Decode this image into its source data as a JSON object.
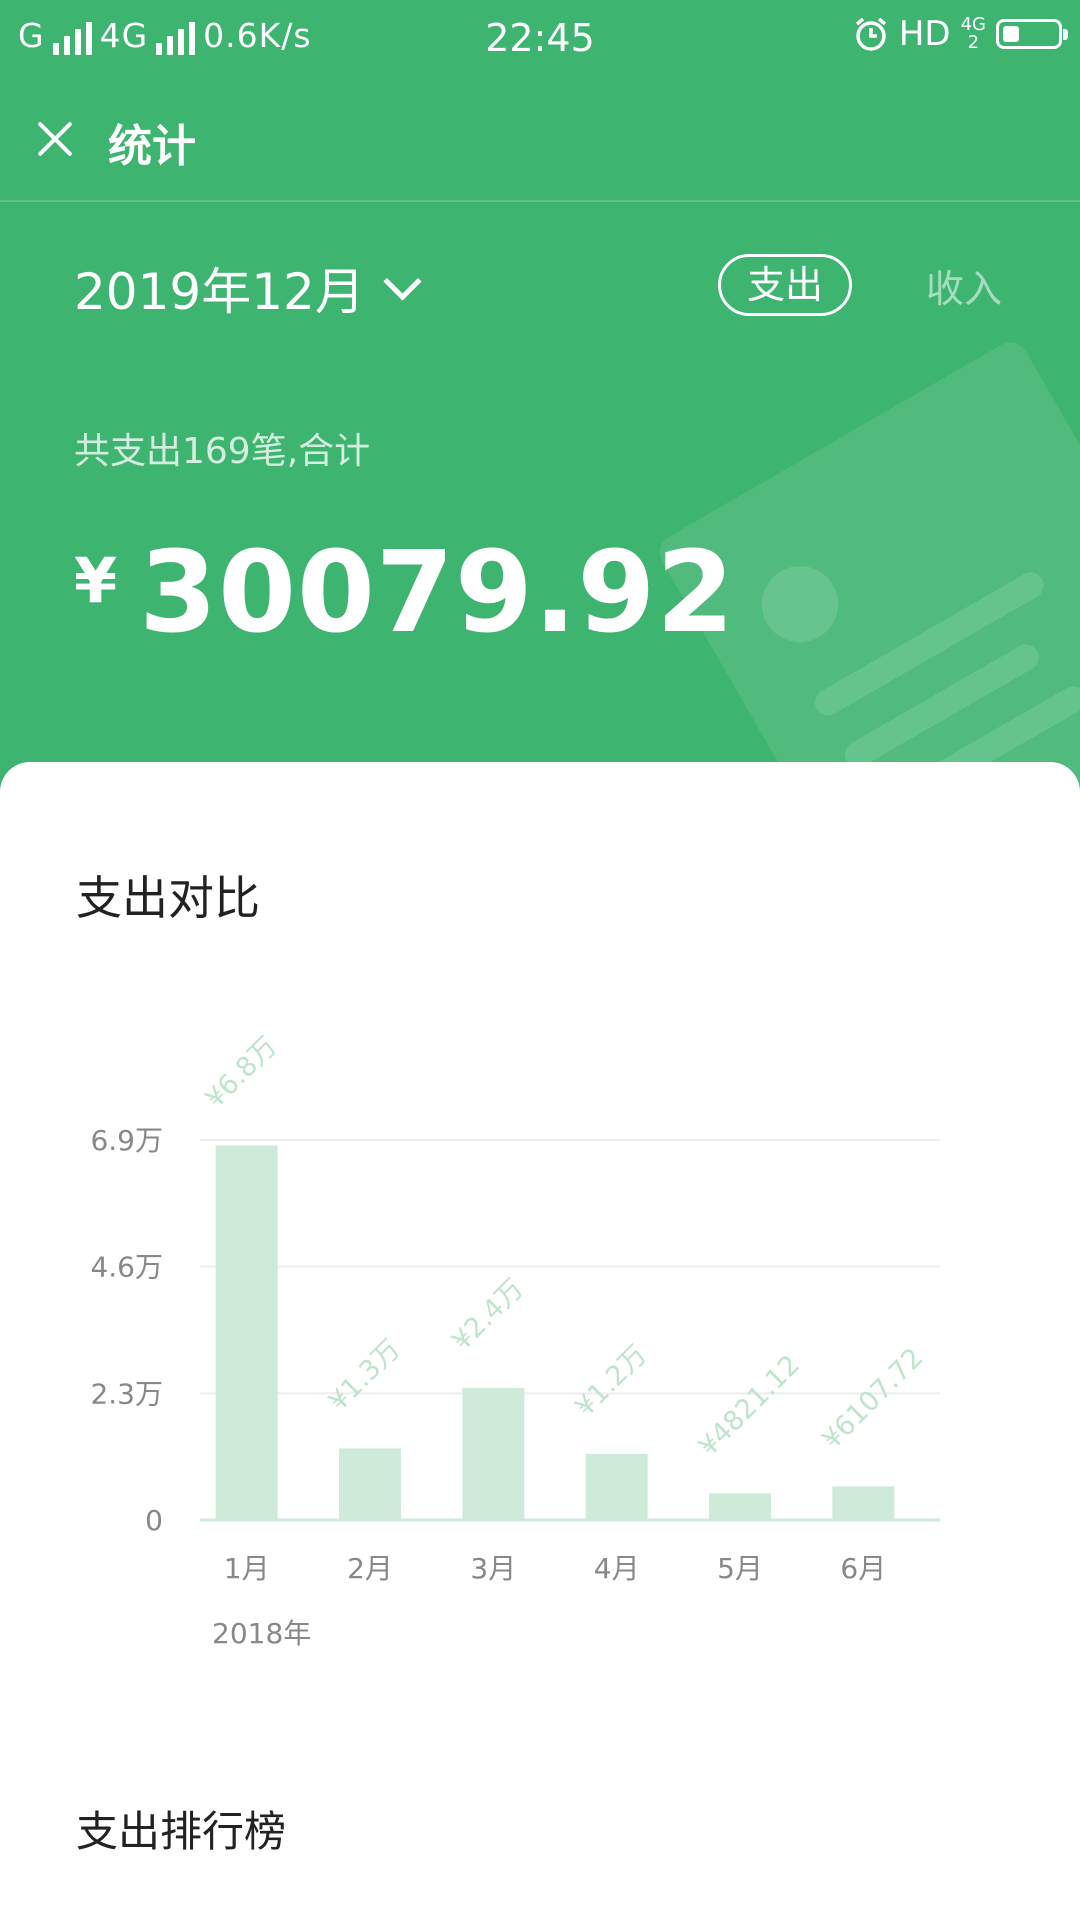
{
  "status_bar": {
    "carrier1": "G",
    "carrier2": "4G",
    "speed": "0.6K/s",
    "time": "22:45",
    "hd": "HD",
    "net_type": "4G",
    "net_sub": "2",
    "battery_level": 0.3
  },
  "header": {
    "title": "统计"
  },
  "period": {
    "month": "2019年12月"
  },
  "tabs": {
    "expense": "支出",
    "income": "收入"
  },
  "summary": {
    "text": "共支出169笔,合计",
    "currency": "¥",
    "total": "30079.92"
  },
  "compare": {
    "title": "支出对比",
    "year": "2018年"
  },
  "ranking": {
    "title": "支出排行榜"
  },
  "colors": {
    "primary": "#3db46f",
    "bar": "#cdebd8",
    "bar_label": "#bfe4cc"
  },
  "chart_data": {
    "type": "bar",
    "title": "支出对比",
    "categories": [
      "1月",
      "2月",
      "3月",
      "4月",
      "5月",
      "6月"
    ],
    "values": [
      68000,
      13000,
      24000,
      12000,
      4821.12,
      6107.72
    ],
    "labels": [
      "¥6.8万",
      "¥1.3万",
      "¥2.4万",
      "¥1.2万",
      "¥4821.12",
      "¥6107.72"
    ],
    "yticks": [
      0,
      23000,
      46000,
      69000
    ],
    "ytick_labels": [
      "0",
      "2.3万",
      "4.6万",
      "6.9万"
    ],
    "ylim": [
      0,
      69000
    ],
    "xlabel": "2018年",
    "grid": true
  }
}
